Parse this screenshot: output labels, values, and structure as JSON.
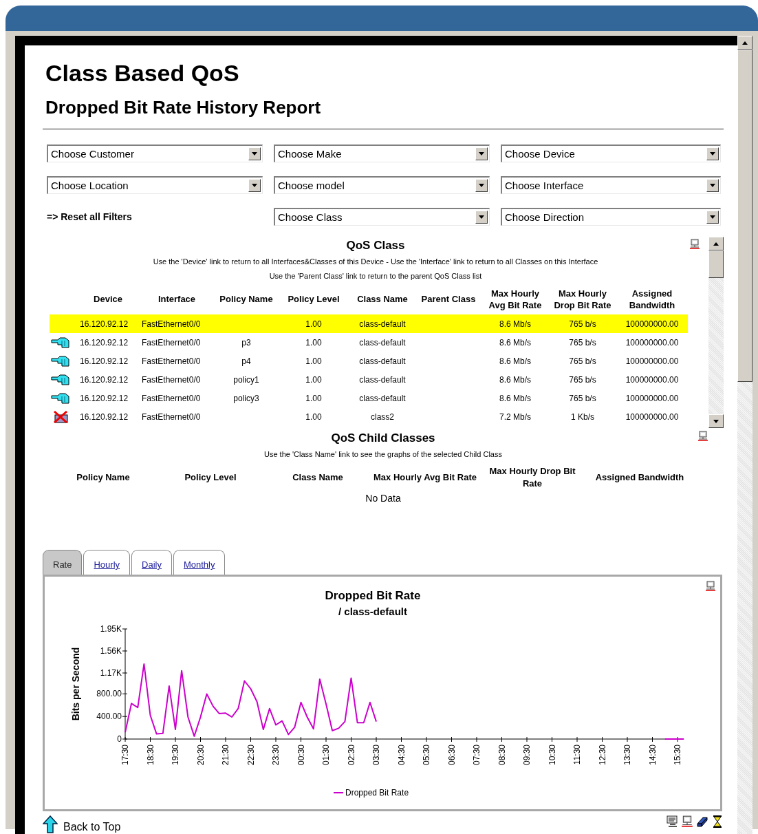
{
  "title": "Class Based QoS",
  "subtitle": "Dropped Bit Rate History Report",
  "filters": [
    {
      "kind": "select",
      "value": "Choose Customer"
    },
    {
      "kind": "select",
      "value": "Choose Make"
    },
    {
      "kind": "select",
      "value": "Choose Device"
    },
    {
      "kind": "select",
      "value": "Choose Location"
    },
    {
      "kind": "select",
      "value": "Choose model"
    },
    {
      "kind": "select",
      "value": "Choose Interface"
    },
    {
      "kind": "link",
      "text": "=> Reset all Filters"
    },
    {
      "kind": "select",
      "value": "Choose Class"
    },
    {
      "kind": "select",
      "value": "Choose Direction"
    }
  ],
  "qos_class": {
    "title": "QoS Class",
    "notes": [
      "Use the 'Device' link to return to all Interfaces&Classes of this Device - Use the 'Interface' link to return to all Classes on this Interface",
      "Use the 'Parent Class' link to return to the parent QoS Class list"
    ],
    "columns": [
      "Device",
      "Interface",
      "Policy Name",
      "Policy Level",
      "Class Name",
      "Parent Class",
      "Max Hourly Avg Bit Rate",
      "Max Hourly Drop Bit Rate",
      "Assigned Bandwidth"
    ],
    "rows": [
      {
        "kind": "plain",
        "selected": true,
        "device": "16.120.92.12",
        "interface": "FastEthernet0/0",
        "policy_level": "1.00",
        "class_name": "class-default",
        "avg_rate": "8.6 Mb/s",
        "drop_rate": "765 b/s",
        "bandwidth": "100000000.00"
      },
      {
        "kind": "link",
        "selected": false,
        "device": "16.120.92.12",
        "interface": "FastEthernet0/0",
        "policy_name": "p3",
        "policy_level": "1.00",
        "class_name": "class-default",
        "avg_rate": "8.6 Mb/s",
        "drop_rate": "765 b/s",
        "bandwidth": "100000000.00"
      },
      {
        "kind": "link",
        "selected": false,
        "device": "16.120.92.12",
        "interface": "FastEthernet0/0",
        "policy_name": "p4",
        "policy_level": "1.00",
        "class_name": "class-default",
        "avg_rate": "8.6 Mb/s",
        "drop_rate": "765 b/s",
        "bandwidth": "100000000.00"
      },
      {
        "kind": "link",
        "selected": false,
        "device": "16.120.92.12",
        "interface": "FastEthernet0/0",
        "policy_name": "policy1",
        "policy_level": "1.00",
        "class_name": "class-default",
        "avg_rate": "8.6 Mb/s",
        "drop_rate": "765 b/s",
        "bandwidth": "100000000.00"
      },
      {
        "kind": "link",
        "selected": false,
        "device": "16.120.92.12",
        "interface": "FastEthernet0/0",
        "policy_name": "policy3",
        "policy_level": "1.00",
        "class_name": "class-default",
        "avg_rate": "8.6 Mb/s",
        "drop_rate": "765 b/s",
        "bandwidth": "100000000.00"
      },
      {
        "kind": "error",
        "selected": false,
        "device": "16.120.92.12",
        "interface": "FastEthernet0/0",
        "policy_level": "1.00",
        "class_name": "class2",
        "avg_rate": "7.2 Mb/s",
        "drop_rate": "1 Kb/s",
        "bandwidth": "100000000.00"
      }
    ]
  },
  "child_classes": {
    "title": "QoS Child Classes",
    "note": "Use the 'Class Name' link to see the graphs of the selected Child Class",
    "columns": [
      "Policy Name",
      "Policy Level",
      "Class Name",
      "Max Hourly Avg Bit Rate",
      "Max Hourly Drop Bit Rate",
      "Assigned Bandwidth"
    ],
    "empty_text": "No Data"
  },
  "tabs": [
    {
      "label": "Rate",
      "selected": true
    },
    {
      "label": "Hourly",
      "selected": false
    },
    {
      "label": "Daily",
      "selected": false
    },
    {
      "label": "Monthly",
      "selected": false
    }
  ],
  "chart_panel": {
    "subtitle": "/ class-default",
    "chart_data": {
      "type": "line",
      "title": "Dropped Bit Rate",
      "ylabel": "Bits per Second",
      "categories": [
        "17:30",
        null,
        null,
        null,
        "18:30",
        null,
        null,
        null,
        "19:30",
        null,
        null,
        null,
        "20:30",
        null,
        null,
        null,
        "21:30",
        null,
        null,
        null,
        "22:30",
        null,
        null,
        null,
        "23:30",
        null,
        null,
        null,
        "00:30",
        null,
        null,
        null,
        "01:30",
        null,
        null,
        null,
        "02:30",
        null,
        null,
        null,
        "03:30",
        null,
        null,
        null,
        "04:30",
        null,
        null,
        null,
        "05:30",
        null,
        null,
        null,
        "06:30",
        null,
        null,
        null,
        "07:30",
        null,
        null,
        null,
        "08:30",
        null,
        null,
        null,
        "09:30",
        null,
        null,
        null,
        "10:30",
        null,
        null,
        null,
        "11:30",
        null,
        null,
        null,
        "12:30",
        null,
        null,
        null,
        "13:30",
        null,
        null,
        null,
        "14:30",
        null,
        null,
        null,
        "15:30",
        null
      ],
      "series": [
        {
          "name": "Dropped Bit Rate",
          "color": "#cc00cc",
          "values": [
            120,
            630,
            560,
            1330,
            420,
            90,
            100,
            940,
            170,
            1210,
            390,
            50,
            390,
            800,
            580,
            450,
            460,
            390,
            540,
            1030,
            890,
            660,
            170,
            540,
            250,
            320,
            80,
            210,
            650,
            390,
            180,
            1060,
            620,
            150,
            190,
            310,
            1080,
            290,
            290,
            650,
            310,
            null,
            null,
            null,
            null,
            null,
            null,
            null,
            null,
            null,
            null,
            null,
            null,
            null,
            null,
            null,
            null,
            null,
            null,
            null,
            null,
            null,
            null,
            null,
            null,
            null,
            null,
            null,
            null,
            null,
            null,
            null,
            null,
            null,
            null,
            null,
            null,
            null,
            null,
            null,
            null,
            null,
            null,
            null,
            null,
            null,
            0,
            0,
            0,
            0
          ]
        }
      ],
      "ylim": [
        0,
        1950
      ],
      "yticks": [
        {
          "value": 0,
          "label": "0"
        },
        {
          "value": 400,
          "label": "400.00"
        },
        {
          "value": 800,
          "label": "800.00"
        },
        {
          "value": 1170,
          "label": "1.17K"
        },
        {
          "value": 1560,
          "label": "1.56K"
        },
        {
          "value": 1950,
          "label": "1.95K"
        }
      ]
    }
  },
  "back_link": "Back to Top"
}
